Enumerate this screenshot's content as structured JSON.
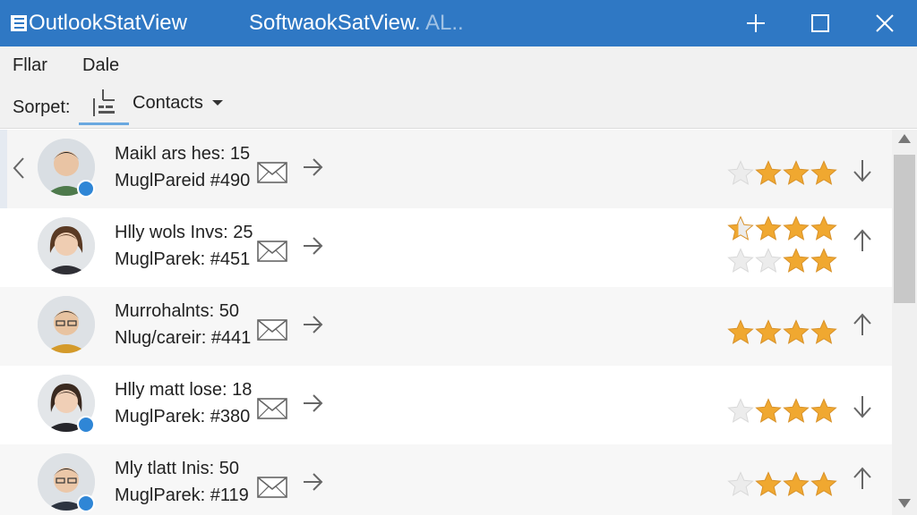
{
  "window": {
    "app_title": "OutlookStatView",
    "subtitle": "SoftwaokSatView.",
    "subtitle_faded": "AL..",
    "accent": "#2f78c4"
  },
  "menu": {
    "items": [
      "Fllar",
      "Dale"
    ]
  },
  "toolbar": {
    "sort_label": "Sorpet:",
    "dropdown_value": "Contacts"
  },
  "contacts": [
    {
      "line1": "Maikl ars hes: 15",
      "line2": "MuglPareid #490",
      "presence": true,
      "trend": "down",
      "stars": [
        [
          0,
          1,
          1,
          1
        ]
      ]
    },
    {
      "line1": "Hlly wols Invs: 25",
      "line2": "MuglParek: #451",
      "presence": false,
      "trend": "up",
      "stars": [
        [
          0.4,
          1,
          1,
          1
        ],
        [
          0,
          0,
          1,
          1
        ]
      ]
    },
    {
      "line1": "Murrohalnts: 50",
      "line2": "Nlug/careir: #441",
      "presence": false,
      "trend": "up",
      "stars": [
        [
          1,
          1,
          1,
          1
        ]
      ]
    },
    {
      "line1": "Hlly matt lose: 18",
      "line2": "MuglParek: #380",
      "presence": true,
      "trend": "down",
      "stars": [
        [
          0,
          1,
          1,
          1
        ]
      ]
    },
    {
      "line1": "Mly tlatt Inis: 50",
      "line2": "MuglParek: #119",
      "presence": true,
      "trend": "up",
      "stars": [
        [
          0,
          1,
          1,
          1
        ]
      ]
    }
  ]
}
